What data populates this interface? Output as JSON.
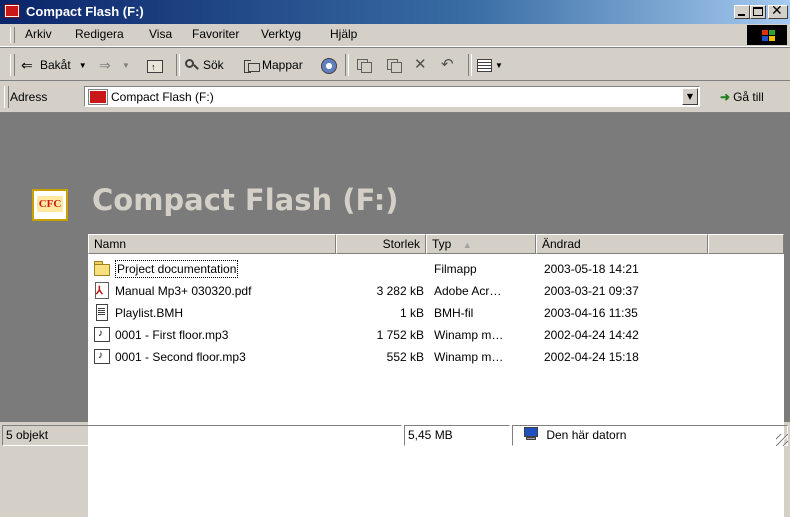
{
  "window": {
    "title": "Compact Flash (F:)"
  },
  "menu": {
    "items": [
      "Arkiv",
      "Redigera",
      "Visa",
      "Favoriter",
      "Verktyg",
      "Hjälp"
    ]
  },
  "toolbar": {
    "back_label": "Bakåt",
    "search_label": "Sök",
    "folders_label": "Mappar",
    "icons": [
      "back-arrow-icon",
      "forward-arrow-icon",
      "up-folder-icon",
      "search-icon",
      "folders-icon",
      "history-icon",
      "move-to-icon",
      "copy-to-icon",
      "delete-icon",
      "undo-icon",
      "views-icon"
    ]
  },
  "address": {
    "label": "Adress",
    "value": "Compact Flash (F:)",
    "go_label": "Gå till"
  },
  "folder": {
    "icon_text": "CFC",
    "heading": "Compact Flash (F:)"
  },
  "filelist": {
    "columns": [
      "Namn",
      "Storlek",
      "Typ",
      "Ändrad"
    ],
    "sort_indicator": "▲",
    "rows": [
      {
        "name": "Project documentation",
        "size": "",
        "type": "Filmapp",
        "modified": "2003-05-18 14:21",
        "icon": "folder-icon"
      },
      {
        "name": "Manual Mp3+ 030320.pdf",
        "size": "3 282 kB",
        "type": "Adobe Acr…",
        "modified": "2003-03-21 09:37",
        "icon": "pdf-icon"
      },
      {
        "name": "Playlist.BMH",
        "size": "1 kB",
        "type": "BMH-fil",
        "modified": "2003-04-16 11:35",
        "icon": "document-icon"
      },
      {
        "name": "0001 - First floor.mp3",
        "size": "1 752 kB",
        "type": "Winamp m…",
        "modified": "2002-04-24 14:42",
        "icon": "audio-file-icon"
      },
      {
        "name": "0001 - Second floor.mp3",
        "size": "552 kB",
        "type": "Winamp m…",
        "modified": "2002-04-24 15:18",
        "icon": "audio-file-icon"
      }
    ]
  },
  "status": {
    "objects": "5 objekt",
    "size": "5,45 MB",
    "zone": "Den här datorn"
  },
  "colors": {
    "title_bar": "#0a246a",
    "chrome": "#d4d0c8",
    "content_background": "#7b7b7b"
  }
}
